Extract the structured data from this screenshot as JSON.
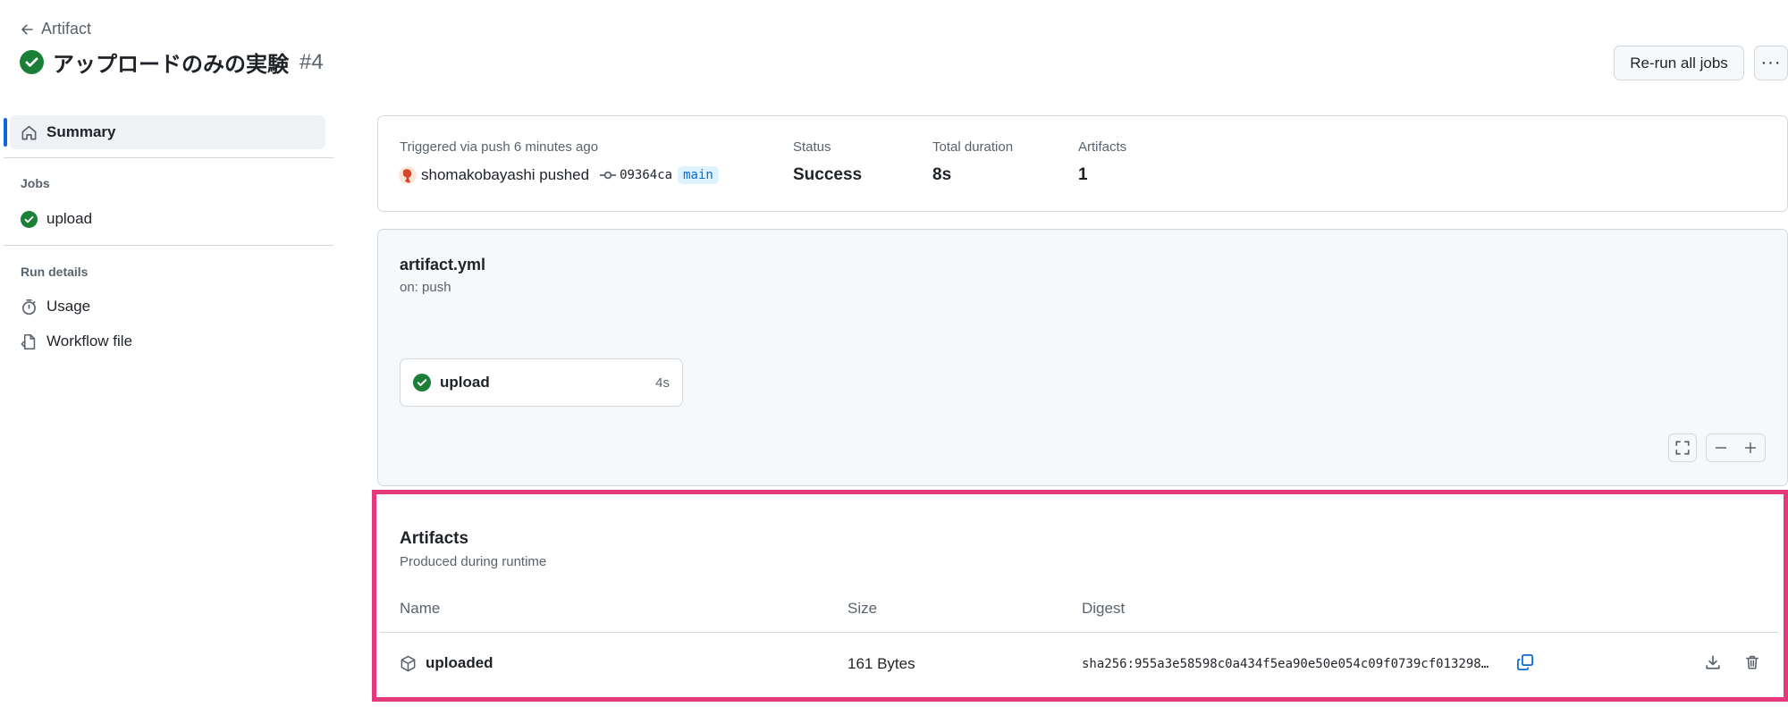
{
  "header": {
    "back_label": "Artifact",
    "title": "アップロードのみの実験",
    "run_number": "#4",
    "rerun_label": "Re-run all jobs",
    "more_label": "···"
  },
  "sidebar": {
    "summary_label": "Summary",
    "jobs_heading": "Jobs",
    "jobs": [
      {
        "label": "upload"
      }
    ],
    "run_details_heading": "Run details",
    "details": [
      {
        "label": "Usage"
      },
      {
        "label": "Workflow file"
      }
    ]
  },
  "summary": {
    "trigger_text": "Triggered via push 6 minutes ago",
    "actor_text": "shomakobayashi pushed",
    "commit_sha": "09364ca",
    "branch": "main",
    "status_label": "Status",
    "status_value": "Success",
    "duration_label": "Total duration",
    "duration_value": "8s",
    "artifacts_label": "Artifacts",
    "artifacts_value": "1"
  },
  "workflow": {
    "file_name": "artifact.yml",
    "trigger": "on: push",
    "job_name": "upload",
    "job_duration": "4s"
  },
  "artifacts": {
    "title": "Artifacts",
    "subtitle": "Produced during runtime",
    "col_name": "Name",
    "col_size": "Size",
    "col_digest": "Digest",
    "rows": [
      {
        "name": "uploaded",
        "size": "161 Bytes",
        "digest": "sha256:955a3e58598c0a434f5ea90e50e054c09f0739cf013298…"
      }
    ]
  },
  "colors": {
    "success": "#1a7f37",
    "accent": "#0969da",
    "highlight": "#e5387d"
  }
}
